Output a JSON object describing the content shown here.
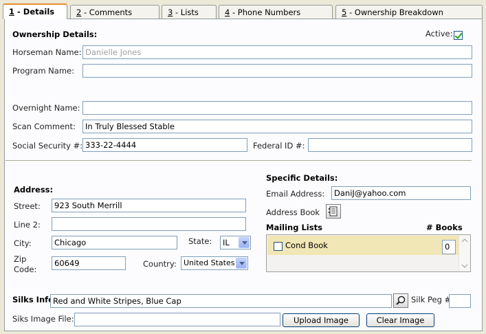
{
  "tabs": [
    {
      "key": "1",
      "label": " - Details"
    },
    {
      "key": "2",
      "label": " - Comments"
    },
    {
      "key": "3",
      "label": " - Lists"
    },
    {
      "key": "4",
      "label": " - Phone Numbers"
    },
    {
      "key": "5",
      "label": " - Ownership Breakdown"
    }
  ],
  "ownership": {
    "heading": "Ownership Details:",
    "active_label": "Active:",
    "active_checked": true,
    "horseman_label": "Horseman Name:",
    "horseman_value": "Danielle Jones",
    "program_label": "Program Name:",
    "program_value": "",
    "overnight_label": "Overnight Name:",
    "overnight_value": "",
    "scan_label": "Scan Comment:",
    "scan_value": "In Truly Blessed Stable",
    "ssn_label": "Social Security #:",
    "ssn_value": "333-22-4444",
    "federal_label": "Federal ID #:",
    "federal_value": ""
  },
  "address": {
    "heading": "Address:",
    "street_label": "Street:",
    "street_value": "923 South Merrill",
    "line2_label": "Line 2:",
    "line2_value": "",
    "city_label": "City:",
    "city_value": "Chicago",
    "state_label": "State:",
    "state_value": "IL",
    "zip_label_1": "Zip",
    "zip_label_2": "Code:",
    "zip_value": "60649",
    "country_label": "Country:",
    "country_value": "United States"
  },
  "specific": {
    "heading": "Specific Details:",
    "email_label": "Email Address:",
    "email_value": "DaniJ@yahoo.com",
    "address_book_label": "Address Book",
    "mailing_heading": "Mailing Lists",
    "books_heading": "# Books",
    "mailing_items": [
      {
        "name": "Cond Book",
        "checked": false,
        "books": "0"
      }
    ]
  },
  "silks": {
    "info_label": "Silks Info:",
    "info_value": "Red and White Stripes, Blue Cap",
    "peg_label": "Silk Peg #",
    "peg_value": "",
    "image_label": "Siks Image File:",
    "image_value": "",
    "upload_label": "Upload Image",
    "clear_label": "Clear Image"
  }
}
